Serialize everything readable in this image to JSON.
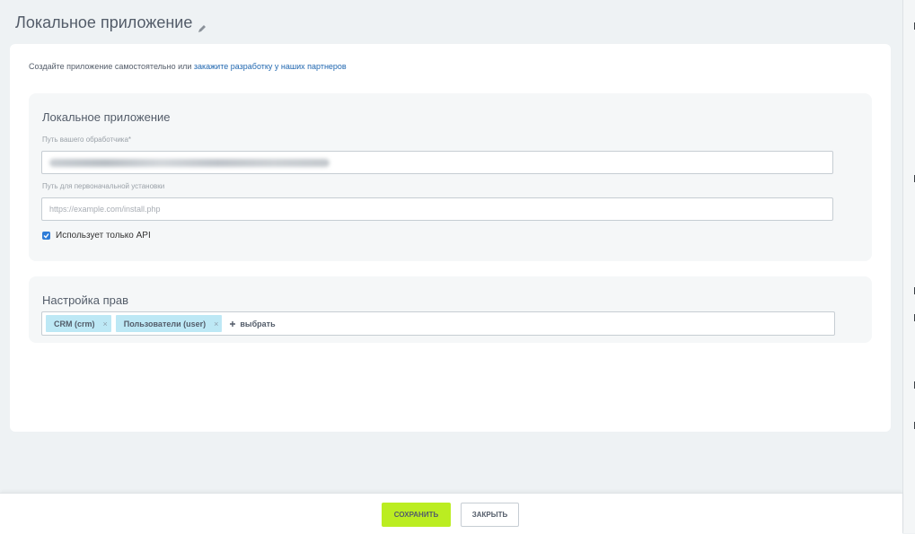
{
  "page": {
    "title": "Локальное приложение",
    "edit_icon": "pencil-icon"
  },
  "intro": {
    "text": "Создайте приложение самостоятельно или ",
    "link": "закажите разработку у наших партнеров"
  },
  "app_section": {
    "title": "Локальное приложение",
    "handler_label": "Путь вашего обработчика*",
    "handler_value_blurred": true,
    "install_label": "Путь для первоначальной установки",
    "install_placeholder": "https://example.com/install.php",
    "api_only_label": "Использует только API",
    "api_only_checked": true
  },
  "rights_section": {
    "title": "Настройка прав",
    "tags": [
      {
        "label": "CRM (crm)",
        "remove": "×"
      },
      {
        "label": "Пользователи (user)",
        "remove": "×"
      }
    ],
    "add_label": "выбрать",
    "add_icon": "plus-icon"
  },
  "footer": {
    "save_label": "СОХРАНИТЬ",
    "close_label": "ЗАКРЫТЬ"
  },
  "colors": {
    "accent_save": "#bbed21",
    "tag_bg": "#bde8f5",
    "link": "#2067b0",
    "checkbox": "#2f7dd8"
  }
}
